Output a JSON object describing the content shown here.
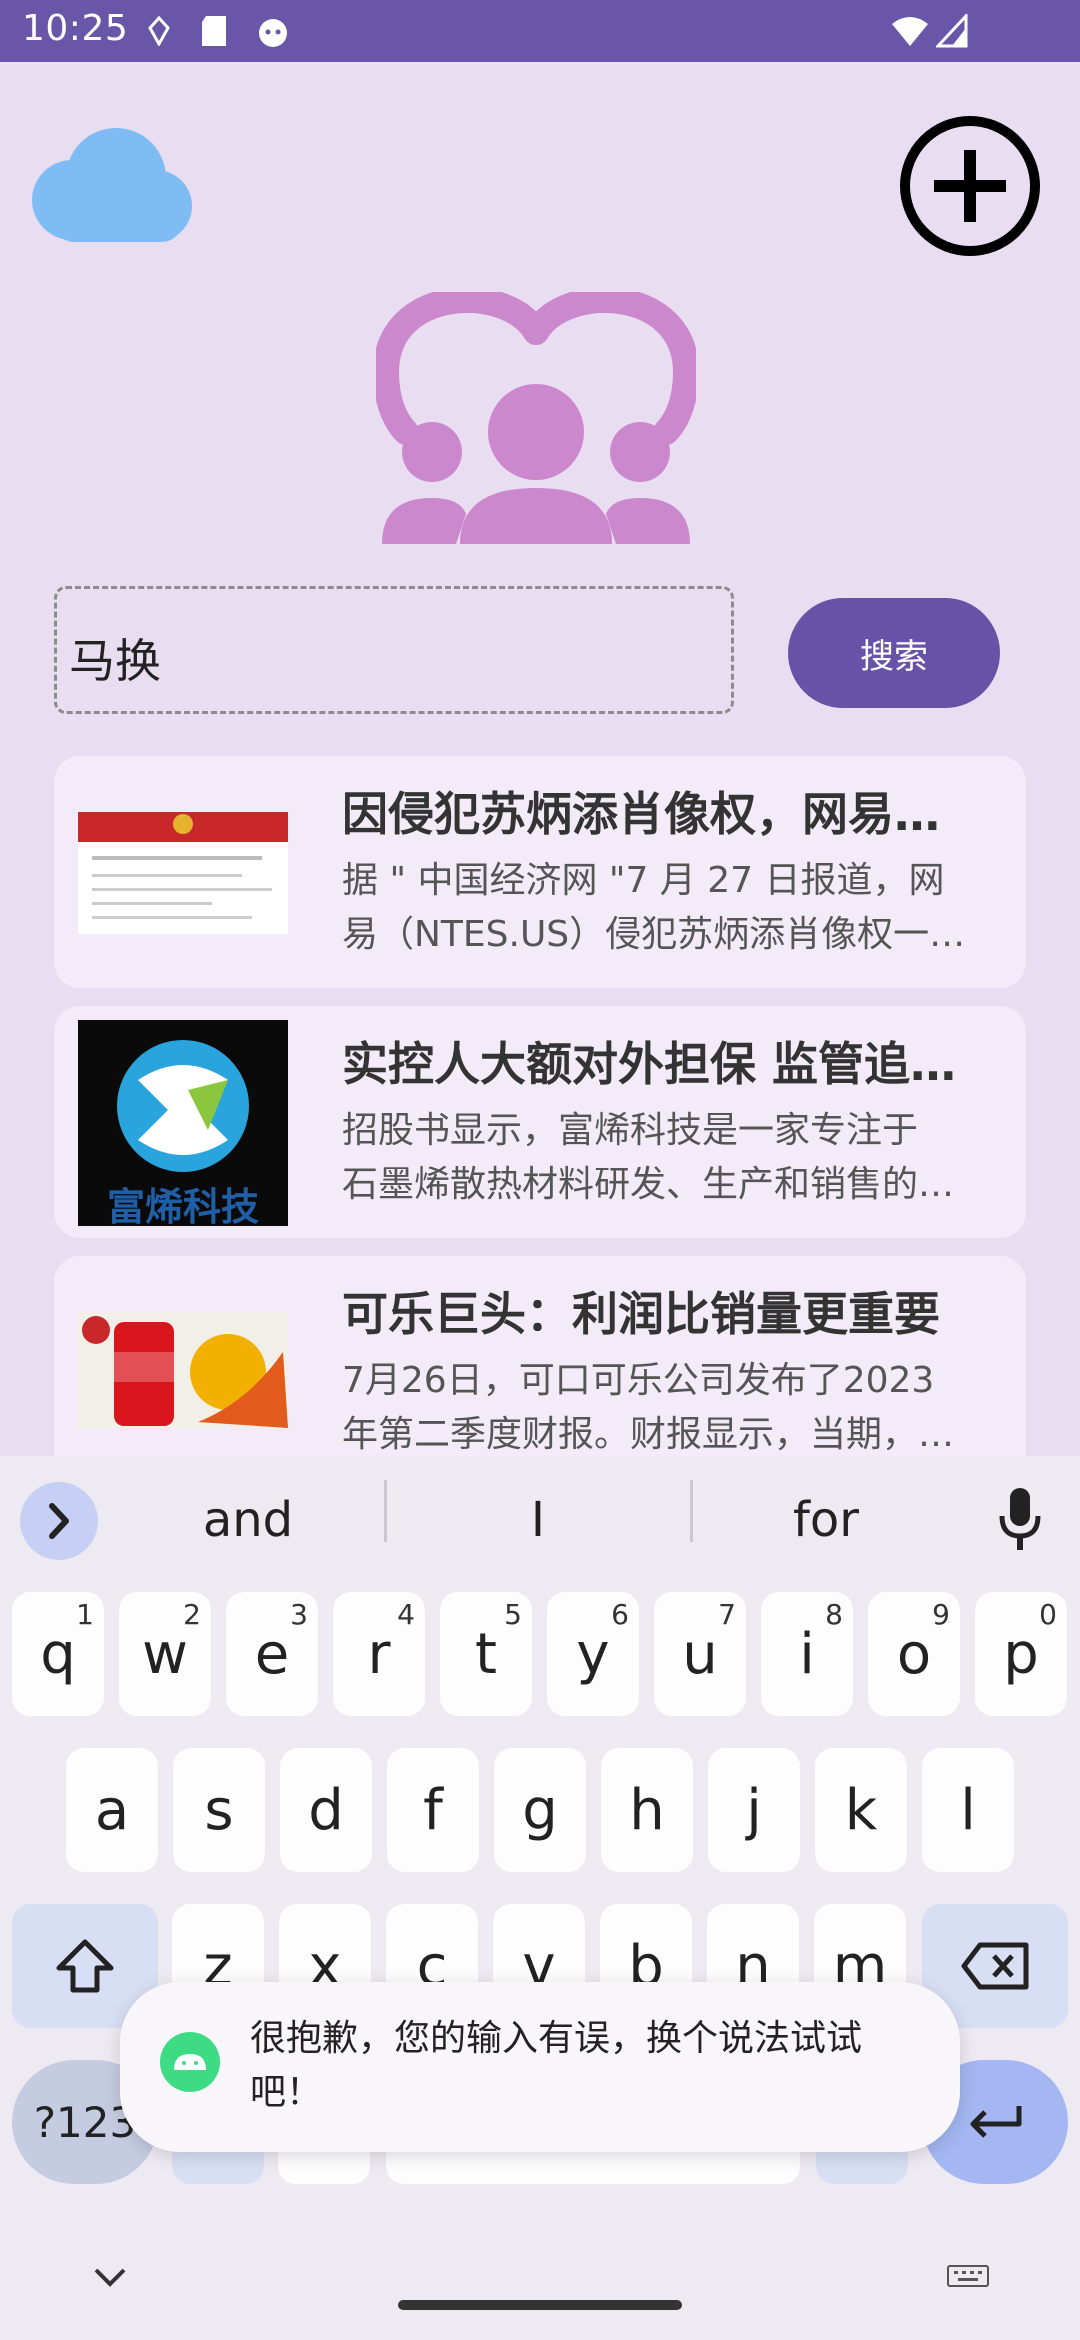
{
  "status_bar": {
    "time": "10:25"
  },
  "search": {
    "value": "马换",
    "button_label": "搜索"
  },
  "news": [
    {
      "title": "因侵犯苏炳添肖像权，网易…",
      "desc_line1": "据 \" 中国经济网 \"7 月 27 日报道，网",
      "desc_line2": "易（NTES.US）侵犯苏炳添肖像权一…"
    },
    {
      "title": "实控人大额对外担保 监管追…",
      "desc_line1": "招股书显示，富烯科技是一家专注于",
      "desc_line2": "石墨烯散热材料研发、生产和销售的…",
      "thumb_text": "富烯科技"
    },
    {
      "title": "可乐巨头：利润比销量更重要",
      "desc_line1": "7月26日，可口可乐公司发布了2023",
      "desc_line2": "年第二季度财报。财报显示，当期，…"
    }
  ],
  "keyboard": {
    "suggestions": [
      "and",
      "I",
      "for"
    ],
    "row1": [
      {
        "k": "q",
        "h": "1"
      },
      {
        "k": "w",
        "h": "2"
      },
      {
        "k": "e",
        "h": "3"
      },
      {
        "k": "r",
        "h": "4"
      },
      {
        "k": "t",
        "h": "5"
      },
      {
        "k": "y",
        "h": "6"
      },
      {
        "k": "u",
        "h": "7"
      },
      {
        "k": "i",
        "h": "8"
      },
      {
        "k": "o",
        "h": "9"
      },
      {
        "k": "p",
        "h": "0"
      }
    ],
    "row2": [
      "a",
      "s",
      "d",
      "f",
      "g",
      "h",
      "j",
      "k",
      "l"
    ],
    "row3": [
      "z",
      "x",
      "c",
      "v",
      "b",
      "n",
      "m"
    ],
    "symbols_label": "?123"
  },
  "toast": {
    "text": "很抱歉，您的输入有误，换个说法试试吧！"
  },
  "colors": {
    "primary": "#6752a8",
    "statusbar": "#6a56a8",
    "accent_pink": "#cc88cc",
    "cloud": "#7fbcf4",
    "background": "#e9ddf2"
  }
}
